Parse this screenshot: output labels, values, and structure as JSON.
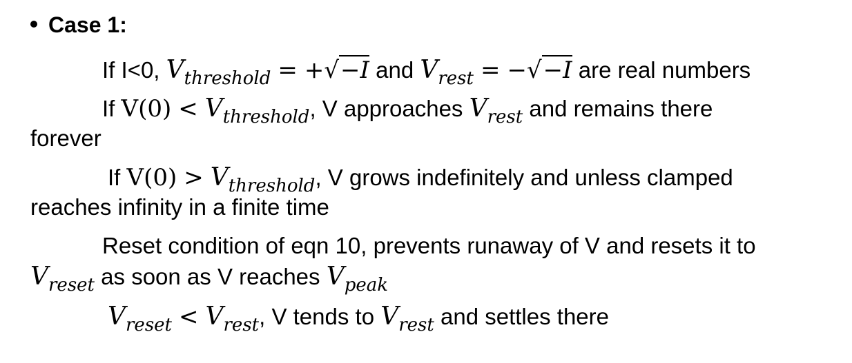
{
  "heading": {
    "bullet": "•",
    "title": "Case 1:"
  },
  "line1": {
    "pre": "If I<0,",
    "v1": "V",
    "v1_sub": "threshold",
    "eq1": "=",
    "sign1": "+",
    "sqrt1": "√",
    "rad1": "−I",
    "and": "and",
    "v2": "V",
    "v2_sub": "rest",
    "eq2": "=",
    "sign2": "−",
    "sqrt2": "√",
    "rad2": "−I",
    "post": "are real numbers"
  },
  "line2": {
    "pre": "If",
    "vfunc": "V(0)",
    "lt": "<",
    "v": "V",
    "v_sub": "threshold",
    "comma": ",",
    "mid": "V approaches",
    "v2": "V",
    "v2_sub": "rest",
    "post": "and remains there"
  },
  "line2b": {
    "text": "forever"
  },
  "line3": {
    "pre": "If",
    "vfunc": "V(0)",
    "gt": ">",
    "v": "V",
    "v_sub": "threshold",
    "comma": ",",
    "post": "V grows indefinitely and unless clamped"
  },
  "line3b": {
    "text": "reaches infinity in a finite time"
  },
  "line4": {
    "text": "Reset condition of eqn 10, prevents runaway of V and resets it to"
  },
  "line4b": {
    "v": "V",
    "v_sub": "reset",
    "mid": "as soon as V reaches",
    "v2": "V",
    "v2_sub": "peak"
  },
  "line5": {
    "v1": "V",
    "v1_sub": "reset",
    "lt": "<",
    "v2": "V",
    "v2_sub": "rest",
    "comma": ",",
    "mid": "V tends to",
    "v3": "V",
    "v3_sub": "rest",
    "post": "and settles there"
  }
}
